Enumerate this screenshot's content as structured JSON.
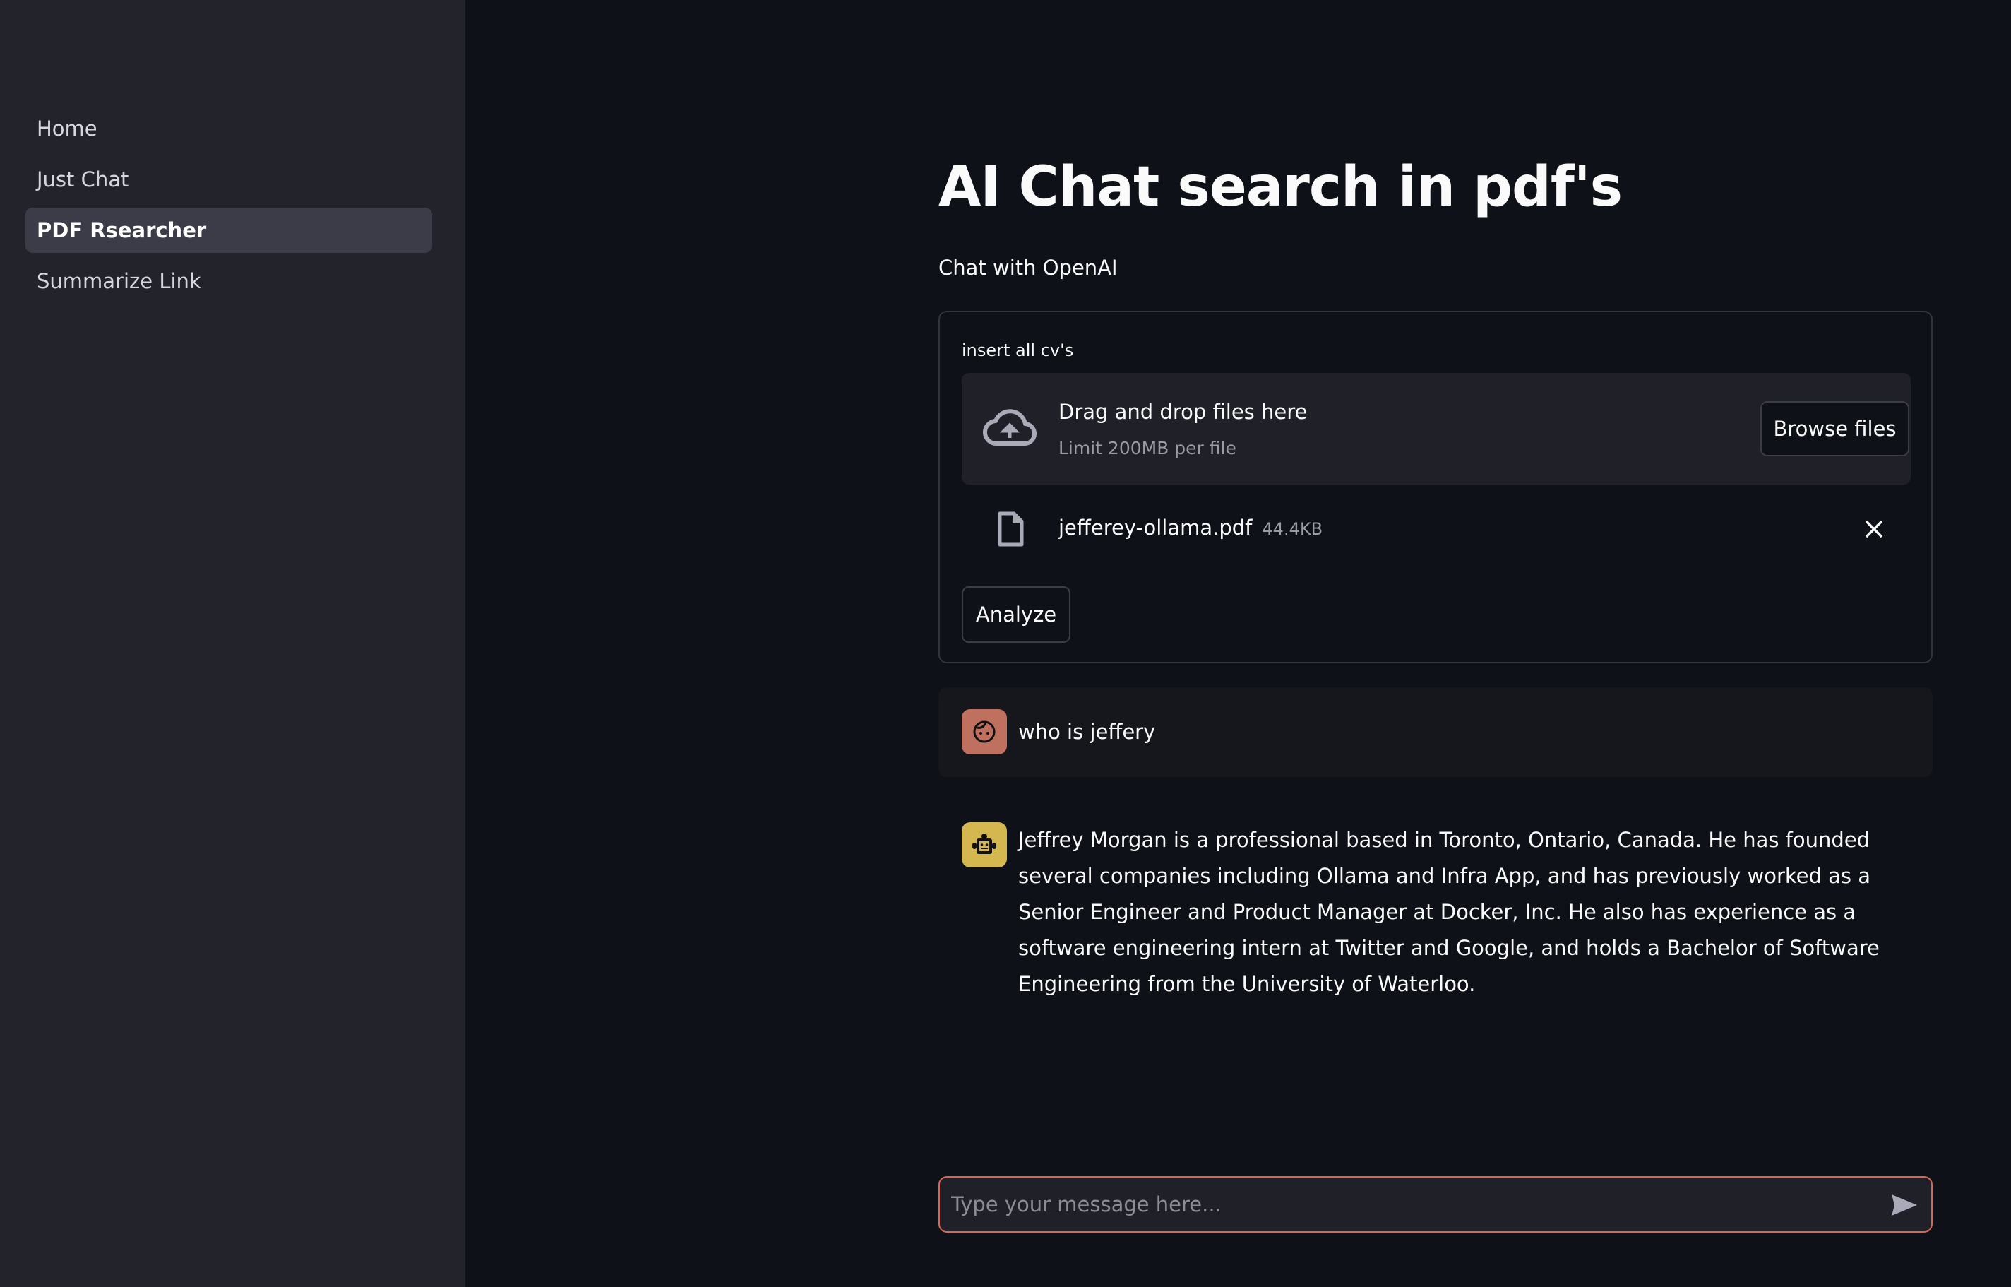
{
  "sidebar": {
    "items": [
      {
        "label": "Home",
        "active": false
      },
      {
        "label": "Just Chat",
        "active": false
      },
      {
        "label": "PDF Rsearcher",
        "active": true
      },
      {
        "label": "Summarize Link",
        "active": false
      }
    ]
  },
  "main": {
    "title": "AI Chat search in pdf's",
    "subtitle": "Chat with OpenAI",
    "form": {
      "label": "insert all cv's",
      "dropzone": {
        "title": "Drag and drop files here",
        "limit": "Limit 200MB per file",
        "browse_label": "Browse files",
        "icon": "cloud-upload-icon"
      },
      "file": {
        "name": "jefferey-ollama.pdf",
        "size": "44.4KB",
        "icon": "file-icon"
      },
      "analyze_label": "Analyze"
    },
    "messages": [
      {
        "role": "user",
        "avatar_color": "#c0705e",
        "text": "who is jeffery"
      },
      {
        "role": "assistant",
        "avatar_color": "#d4b84f",
        "text": "Jeffrey Morgan is a professional based in Toronto, Ontario, Canada. He has founded several companies including Ollama and Infra App, and has previously worked as a Senior Engineer and Product Manager at Docker, Inc. He also has experience as a software engineering intern at Twitter and Google, and holds a Bachelor of Software Engineering from the University of Waterloo."
      }
    ],
    "chat_input": {
      "placeholder": "Type your message here...",
      "value": ""
    }
  },
  "colors": {
    "background": "#0e1117",
    "sidebar": "#23232b",
    "accent": "#d9664f"
  }
}
